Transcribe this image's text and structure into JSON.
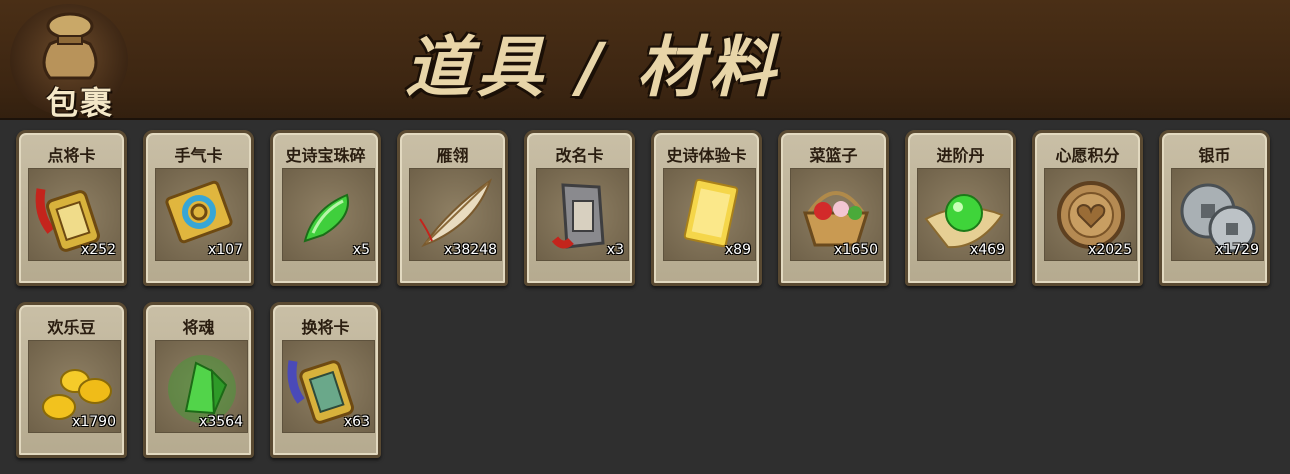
{
  "header": {
    "bag_label": "包裹",
    "title": "道具 / 材料"
  },
  "items": [
    {
      "name": "点将卡",
      "count": "x252",
      "icon": "general-card-icon"
    },
    {
      "name": "手气卡",
      "count": "x107",
      "icon": "luck-card-icon"
    },
    {
      "name": "史诗宝珠碎",
      "count": "x5",
      "icon": "epic-gem-shard-icon"
    },
    {
      "name": "雁翎",
      "count": "x38248",
      "icon": "feather-icon"
    },
    {
      "name": "改名卡",
      "count": "x3",
      "icon": "rename-card-icon"
    },
    {
      "name": "史诗体验卡",
      "count": "x89",
      "icon": "epic-trial-card-icon"
    },
    {
      "name": "菜篮子",
      "count": "x1650",
      "icon": "basket-icon"
    },
    {
      "name": "进阶丹",
      "count": "x469",
      "icon": "advance-pill-icon"
    },
    {
      "name": "心愿积分",
      "count": "x2025",
      "icon": "wish-points-coin-icon"
    },
    {
      "name": "银币",
      "count": "x1729",
      "icon": "silver-coin-icon"
    },
    {
      "name": "欢乐豆",
      "count": "x1790",
      "icon": "happy-beans-icon"
    },
    {
      "name": "将魂",
      "count": "x3564",
      "icon": "general-soul-icon"
    },
    {
      "name": "换将卡",
      "count": "x63",
      "icon": "swap-general-card-icon"
    }
  ]
}
